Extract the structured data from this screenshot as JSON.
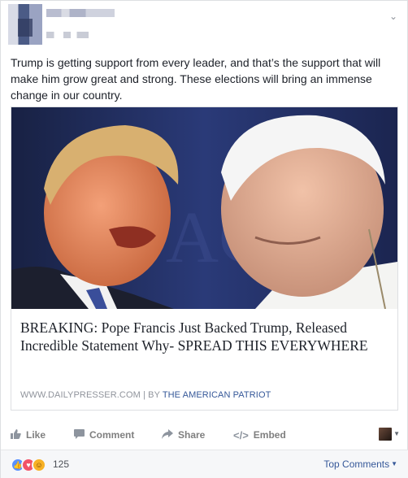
{
  "post": {
    "text": "Trump is getting support from every leader, and that’s the support that will make him grow great and strong. These elections will bring an immense change in our country."
  },
  "link": {
    "title": "BREAKING: Pope Francis Just Backed Trump, Released Incredible Statement Why- SPREAD THIS EVERYWHERE",
    "domain": "WWW.DAILYPRESSER.COM",
    "separator": "|",
    "by_label": "BY",
    "author": "THE AMERICAN PATRIOT"
  },
  "actions": {
    "like": "Like",
    "comment": "Comment",
    "share": "Share",
    "embed": "Embed"
  },
  "reactions": {
    "count": "125",
    "top_comments": "Top Comments"
  },
  "icons": {
    "options": "chevron-down-icon",
    "like": "thumbs-up-icon",
    "comment": "speech-bubble-icon",
    "share": "share-arrow-icon",
    "embed": "code-icon"
  },
  "colors": {
    "link_blue": "#365899",
    "muted": "#90949c",
    "reaction_like": "#5890ff",
    "reaction_love": "#f25268",
    "reaction_haha": "#f7b125"
  }
}
